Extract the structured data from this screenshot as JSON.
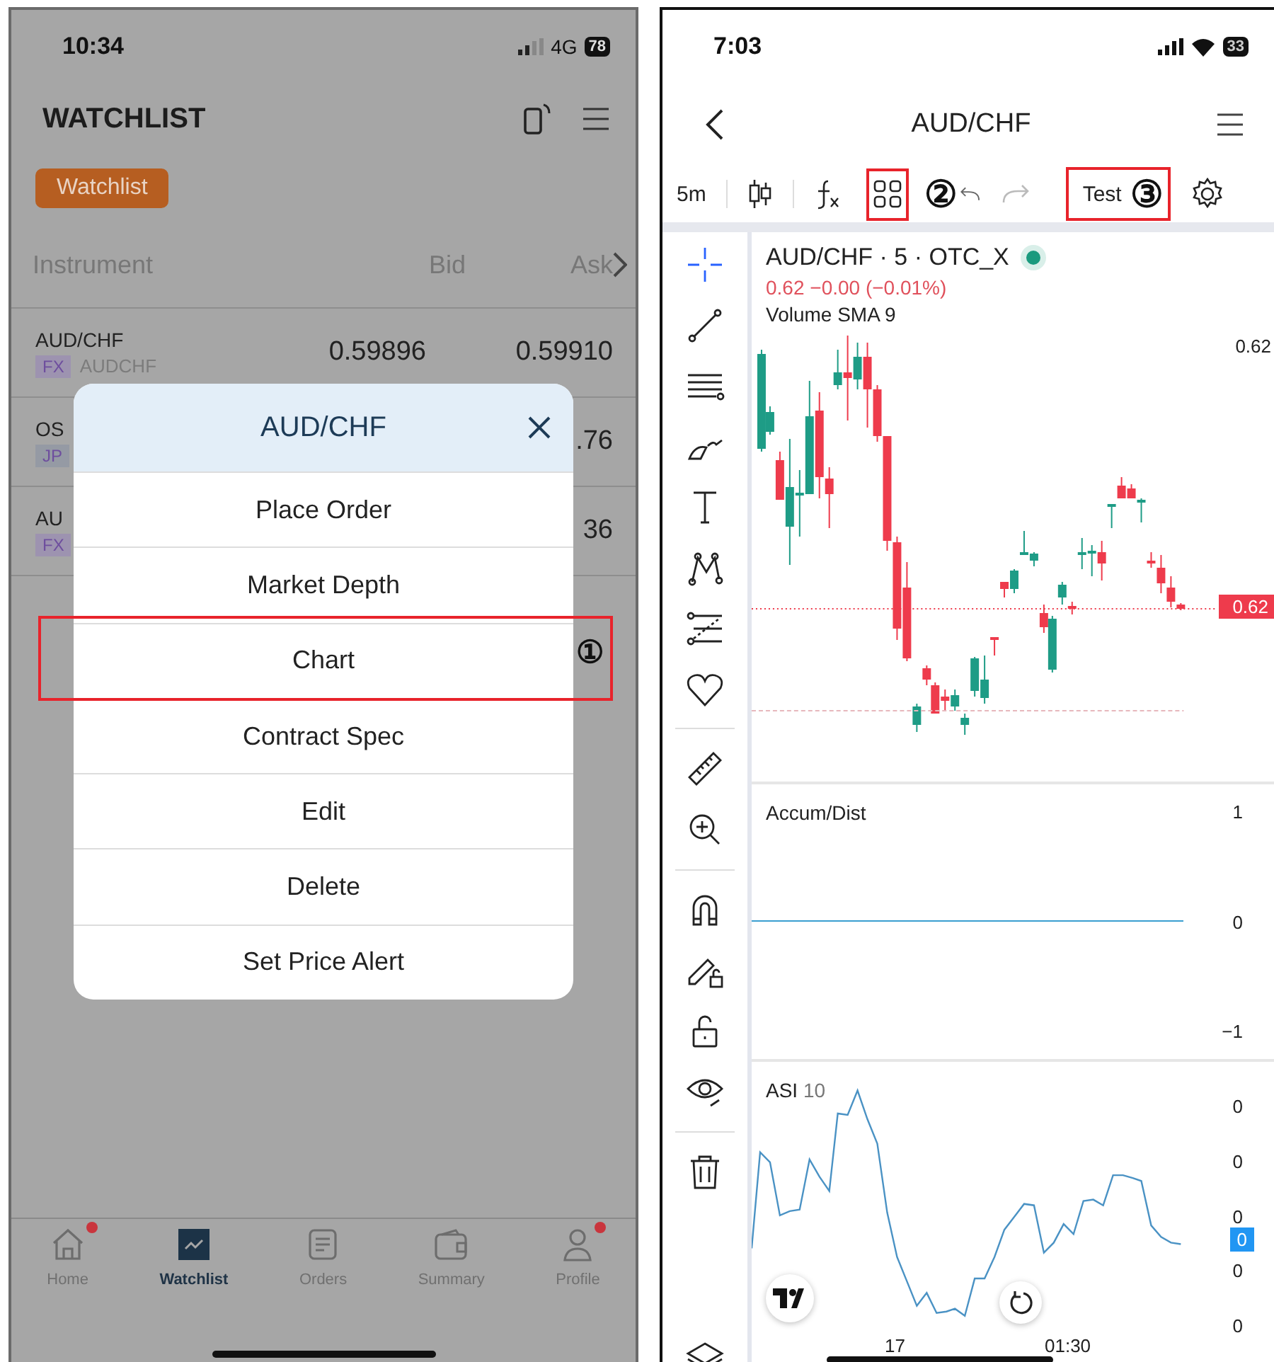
{
  "left_screen": {
    "status_bar": {
      "time": "10:34",
      "network": "4G",
      "battery": "78"
    },
    "title": "WATCHLIST",
    "watchlist_tab": {
      "label": "Watchlist",
      "selected": true
    },
    "columns": [
      "Instrument",
      "Bid",
      "Ask"
    ],
    "rows": [
      {
        "symbol": "AUD/CHF",
        "tag": "FX",
        "color": "#9d93b0",
        "code": "AUDCHF",
        "bid": "0.59896",
        "ask": "0.59910"
      },
      {
        "symbol": "OS",
        "tag": "JP",
        "color": "#959aa4",
        "ask": ".76"
      },
      {
        "symbol": "AU",
        "tag": "FX",
        "color": "#9d93b0",
        "ask": "36"
      }
    ],
    "menu": {
      "title": "AUD/CHF",
      "items": [
        {
          "label": "Place Order",
          "highlighted": false
        },
        {
          "label": "Market Depth",
          "highlighted": false
        },
        {
          "label": "Chart",
          "highlighted": true,
          "marker": "①"
        },
        {
          "label": "Contract Spec",
          "highlighted": false
        },
        {
          "label": "Edit",
          "highlighted": false
        },
        {
          "label": "Delete",
          "highlighted": false
        },
        {
          "label": "Set Price Alert",
          "highlighted": false
        }
      ]
    },
    "tab_bar": [
      {
        "label": "Home",
        "selected": false,
        "badge": true
      },
      {
        "label": "Watchlist",
        "selected": true,
        "badge": false
      },
      {
        "label": "Orders",
        "selected": false,
        "badge": false
      },
      {
        "label": "Summary",
        "selected": false,
        "badge": false
      },
      {
        "label": "Profile",
        "selected": false,
        "badge": true
      }
    ]
  },
  "right_screen": {
    "status_bar": {
      "time": "7:03",
      "battery": "33"
    },
    "title": "AUD/CHF",
    "toolbar": {
      "interval": "5m",
      "layout_button": {
        "highlighted": true,
        "marker": "②"
      },
      "template": {
        "label": "Test",
        "highlighted": true,
        "marker": "③"
      }
    },
    "tools": [
      {
        "kind": "crosshair",
        "selected": true
      },
      {
        "kind": "line",
        "selected": false
      },
      {
        "kind": "hlines",
        "selected": false
      },
      {
        "kind": "brush",
        "selected": false
      },
      {
        "kind": "text",
        "selected": false
      },
      {
        "kind": "pattern",
        "selected": false
      },
      {
        "kind": "fib",
        "selected": false
      },
      {
        "kind": "heart",
        "selected": false
      },
      {
        "kind": "divider"
      },
      {
        "kind": "ruler",
        "selected": false
      },
      {
        "kind": "zoom",
        "selected": false
      },
      {
        "kind": "divider"
      },
      {
        "kind": "magnet",
        "selected": false
      },
      {
        "kind": "pencil-lock",
        "selected": false
      },
      {
        "kind": "lock",
        "selected": false
      },
      {
        "kind": "eye",
        "selected": false
      },
      {
        "kind": "divider"
      },
      {
        "kind": "trash",
        "selected": false
      }
    ],
    "price_pane": {
      "title": "AUD/CHF · 5 · OTC_X",
      "quote": "0.62 −0.00 (−0.01%)",
      "indicator": "Volume SMA 9",
      "axis_labels": [
        "0.62"
      ],
      "last_price": "0.62"
    },
    "accum_pane": {
      "title": "Accum/Dist",
      "axis_labels": [
        "1",
        "0",
        "−1"
      ]
    },
    "asi_pane": {
      "title": "ASI",
      "param": "10",
      "axis_labels": [
        "0",
        "0",
        "0",
        "0",
        "0"
      ],
      "last_value": "0"
    },
    "time_labels": [
      "17",
      "01:30"
    ]
  }
}
